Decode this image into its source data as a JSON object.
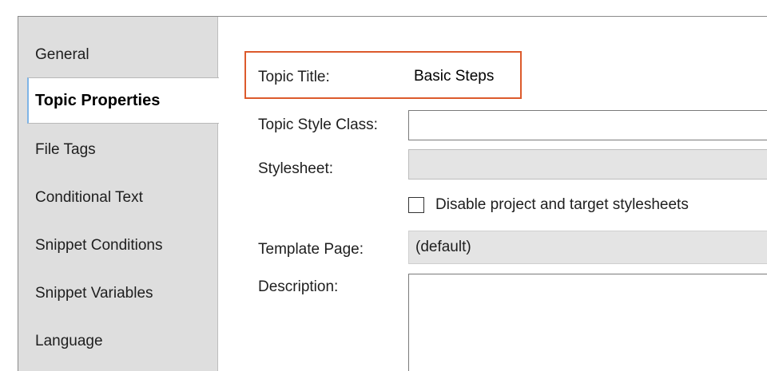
{
  "sidebar": {
    "items": [
      {
        "label": "General",
        "active": false
      },
      {
        "label": "Topic Properties",
        "active": true
      },
      {
        "label": "File Tags",
        "active": false
      },
      {
        "label": "Conditional Text",
        "active": false
      },
      {
        "label": "Snippet Conditions",
        "active": false
      },
      {
        "label": "Snippet Variables",
        "active": false
      },
      {
        "label": "Language",
        "active": false
      }
    ]
  },
  "form": {
    "topic_title": {
      "label": "Topic Title:",
      "value": "Basic Steps"
    },
    "topic_style_class": {
      "label": "Topic Style Class:",
      "value": ""
    },
    "stylesheet": {
      "label": "Stylesheet:",
      "value": ""
    },
    "disable_stylesheets": {
      "label": "Disable project and target stylesheets",
      "checked": false
    },
    "template_page": {
      "label": "Template Page:",
      "value": "(default)"
    },
    "description": {
      "label": "Description:",
      "value": ""
    }
  },
  "colors": {
    "highlight_border": "#dc5a2c",
    "sidebar_bg": "#dedede",
    "active_tab_accent": "#7fb4e6"
  }
}
